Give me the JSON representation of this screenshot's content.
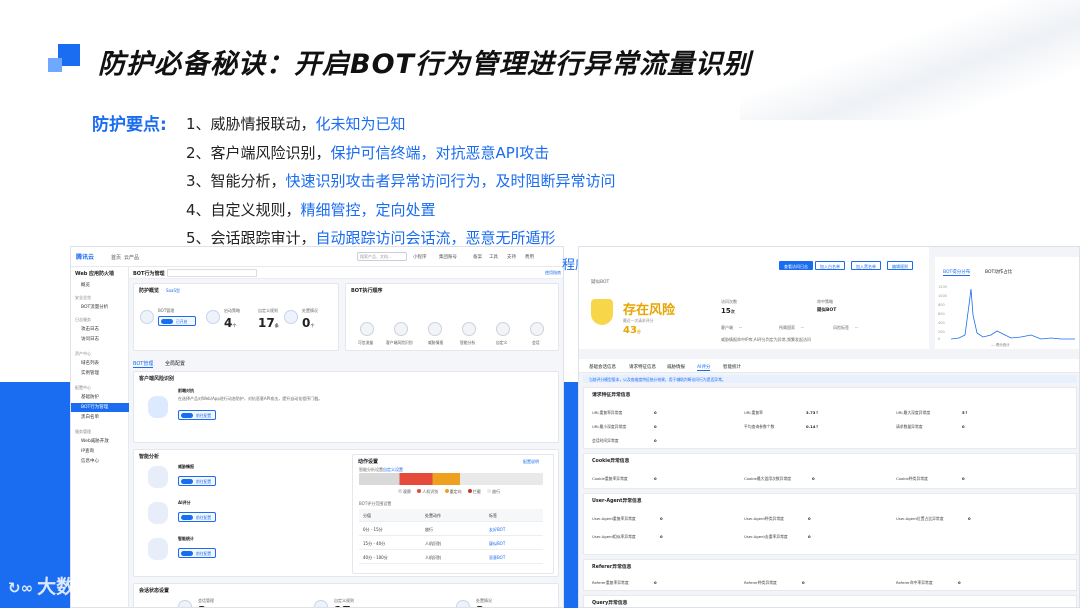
{
  "title": "防护必备秘诀：开启BOT行为管理进行异常流量识别",
  "points_label": "防护要点:",
  "points": [
    {
      "lead": "1、威胁情报联动，",
      "highlight": "化未知为已知"
    },
    {
      "lead": "2、客户端风险识别，",
      "highlight": "保护可信终端，对抗恶意API攻击"
    },
    {
      "lead": "3、智能分析，",
      "highlight": "快速识别攻击者异常访问行为，及时阻断异常访问"
    },
    {
      "lead": "4、自定义规则，",
      "highlight": "精细管控，定向处置"
    },
    {
      "lead": "5、会话跟踪审计，",
      "highlight": "自动跟踪访问会话流，恶意无所遁形"
    }
  ],
  "bridge_text": "程序",
  "watermark": "大数跨境",
  "left_screen": {
    "logo": "腾讯云",
    "top_nav": [
      "首页",
      "云产品"
    ],
    "search_placeholder": "搜索产品、文档...",
    "top_right": [
      "小程序",
      "集团账号",
      "备案",
      "工具",
      "支持",
      "费用"
    ],
    "sidebar_title": "Web 应用防火墙",
    "sidebar_groups": [
      "安全总览",
      "日志服务",
      "资产中心",
      "配置中心",
      "服务管理"
    ],
    "sidebar_items": [
      "概览",
      "BOT流量分析",
      "攻击日志",
      "访问日志",
      "域名列表",
      "实例管理",
      "基础防护",
      "BOT行为管理",
      "黑白名单",
      "Web威胁开放",
      "IP查询",
      "信息中心"
    ],
    "header_title": "BOT行为管理",
    "header_doc": "使用指南",
    "overview": {
      "title": "防护概览",
      "badge": "SaaS型",
      "toggle_label": "BOT管理",
      "switch_text": "已开启",
      "stats": [
        {
          "label": "启动策略",
          "value": "4",
          "unit": "个"
        },
        {
          "label": "自定义规则",
          "value": "17",
          "unit": "条"
        },
        {
          "label": "处置情况",
          "value": "0",
          "unit": "个"
        }
      ]
    },
    "flow": {
      "title": "BOT执行顺序",
      "steps": [
        "可信流量",
        "客户端风险识别",
        "威胁情报",
        "智能分析",
        "自定义",
        "会话"
      ]
    },
    "tabs": [
      "BOT管理",
      "全局配置"
    ],
    "client_risk": {
      "title": "客户端风险识别",
      "name": "前端对抗",
      "desc": "在选择产品对Web/App进行动态防护，对抗恶意API攻击，提升自动化程序门槛。",
      "switch_text": "前往配置"
    },
    "smart": {
      "title": "智能分析",
      "items": [
        {
          "name": "威胁情报",
          "switch_text": "前往配置"
        },
        {
          "name": "AI评分",
          "switch_text": "前往配置"
        },
        {
          "name": "智能统计",
          "switch_text": "前往配置"
        }
      ],
      "panel_title": "动作设置",
      "panel_link": "配置说明",
      "panel_tabs": [
        "智能分析设置",
        "自定义设置"
      ],
      "legend": [
        "观察",
        "人机识别",
        "重定向",
        "拦截",
        "放行"
      ],
      "table_title": "BOT评分范围设置",
      "table_headers": [
        "分值",
        "处置动作",
        "标签"
      ],
      "rows": [
        {
          "range": "0分 - 15分",
          "action": "放行",
          "tag": "友好BOT"
        },
        {
          "range": "15分 - 40分",
          "action": "人机识别",
          "tag": "疑似BOT"
        },
        {
          "range": "40分 - 100分",
          "action": "人机识别",
          "tag": "恶意BOT"
        }
      ]
    },
    "bottom": {
      "title": "会话状态设置",
      "stats": [
        {
          "label": "会话管理",
          "value": "2",
          "unit": "个"
        },
        {
          "label": "自定义规则",
          "value": "17",
          "unit": "条"
        },
        {
          "label": "处置情况",
          "value": "2",
          "unit": "个"
        }
      ]
    }
  },
  "right_screen": {
    "bot_name": "疑似BOT",
    "risk_status": "存在风险",
    "risk_sub": "最近一次请求评分",
    "score": "43",
    "score_unit": "分",
    "buttons": [
      "查看访问日志",
      "加入白名单",
      "加入黑名单",
      "编辑规则"
    ],
    "metrics": [
      {
        "label": "访问次数",
        "value": "15",
        "unit": "次"
      },
      {
        "label": "命中策略",
        "value": "疑似BOT"
      },
      {
        "label": "客户端",
        "value": "--"
      },
      {
        "label": "所属国家",
        "value": "--"
      },
      {
        "label": "风险标签",
        "value": "--"
      }
    ],
    "desc": "威胁情报命中IP库,AI评分判定为异常,频繁发起访问",
    "chart_tabs": [
      "BOT得分分布",
      "BOT动作占比"
    ],
    "chart_ticks": [
      "1200",
      "1000",
      "800",
      "600",
      "400",
      "200",
      "0"
    ],
    "chart_legend": "— 得分统计",
    "tabs": [
      "基础会话信息",
      "请求特征信息",
      "威胁情报",
      "AI评分",
      "智能统计"
    ],
    "note": "当前评分模型版本，以及各维度特征统计结果，用于辅助判断访问行为是否异常。",
    "sections": [
      {
        "title": "请求特征异常信息",
        "fields": [
          {
            "label": "URL重复率异常度",
            "value": "0"
          },
          {
            "label": "URL重复率",
            "value": "3.73↑"
          },
          {
            "label": "URL最大深度异常度",
            "value": "5↑"
          },
          {
            "label": "URL最小深度异常度",
            "value": "0"
          },
          {
            "label": "平均查询参数个数",
            "value": "0.14↑"
          },
          {
            "label": "请求数量异常度",
            "value": "0"
          },
          {
            "label": "会话时间异常度",
            "value": "0"
          }
        ]
      },
      {
        "title": "Cookie异常信息",
        "fields": [
          {
            "label": "Cookie重复率异常度",
            "value": "0"
          },
          {
            "label": "Cookie最大滥用次数异常度",
            "value": "0"
          },
          {
            "label": "Cookie种类异常度",
            "value": "0"
          }
        ]
      },
      {
        "title": "User-Agent异常信息",
        "fields": [
          {
            "label": "User-Agent重复率异常度",
            "value": "0"
          },
          {
            "label": "User-Agent种类异常度",
            "value": "0"
          },
          {
            "label": "User-Agent位置占比异常度",
            "value": "0"
          },
          {
            "label": "User-Agent相似率异常度",
            "value": "0"
          },
          {
            "label": "User-Agent去重率异常度",
            "value": "0"
          }
        ]
      },
      {
        "title": "Referer异常信息",
        "fields": [
          {
            "label": "Referer重复率异常度",
            "value": "0"
          },
          {
            "label": "Referer种类异常度",
            "value": "0"
          },
          {
            "label": "Referer命中率异常度",
            "value": "0"
          }
        ]
      },
      {
        "title": "Query异常信息",
        "fields": []
      }
    ]
  },
  "colors": {
    "accent": "#1a6cf0",
    "risk": "#e6a500",
    "band": "#1a6cf0"
  }
}
